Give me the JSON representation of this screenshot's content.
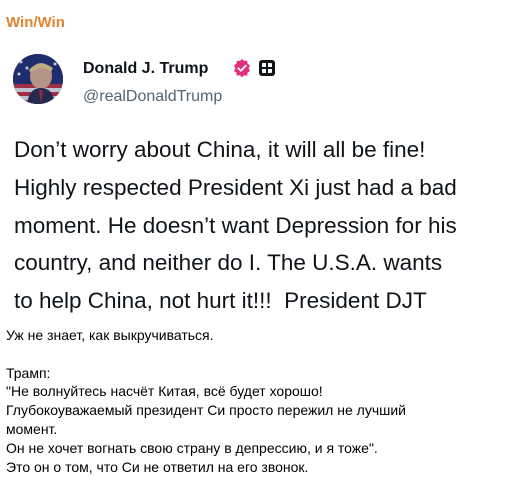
{
  "channel": {
    "name": "Win/Win",
    "name_color": "#e2852f"
  },
  "post": {
    "author_name": "Donald J. Trump",
    "author_handle": "@realDonaldTrump",
    "verified_color": "#e0307c",
    "icons": [
      "avatar-image",
      "verified-badge-icon",
      "affiliate-square-icon"
    ],
    "text_lines": [
      "Don’t worry about China, it will all be fine!",
      "Highly respected President Xi just had a bad",
      "moment. He doesn’t want Depression for his",
      "country, and neither do I. The U.S.A. wants",
      "to help China, not hurt it!!!  President DJT"
    ]
  },
  "message": {
    "lines": [
      "Уж не знает, как выкручиваться.",
      "",
      "Трамп:",
      "\"Не волнуйтесь насчёт Китая, всё будет хорошо!",
      "Глубокоуважаемый президент Си просто пережил не лучший",
      "момент.",
      "Он не хочет вогнать свою страну в депрессию, и я тоже\".",
      "Это он о том, что Си не ответил на его звонок."
    ]
  }
}
